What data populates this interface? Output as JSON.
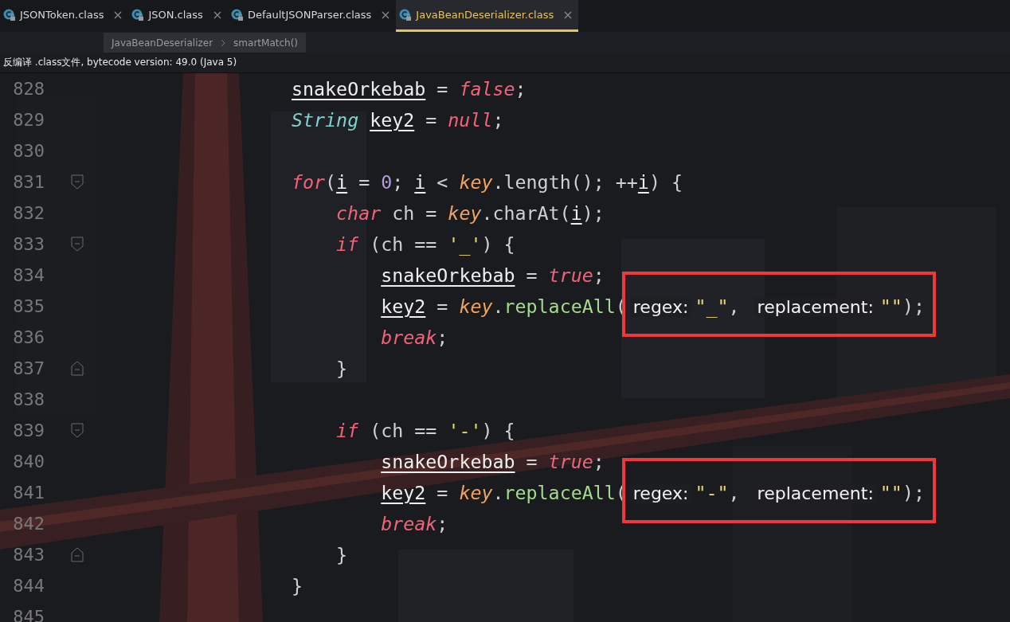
{
  "tabs": [
    {
      "label": "JSONToken.class",
      "selected": false
    },
    {
      "label": "JSON.class",
      "selected": false
    },
    {
      "label": "DefaultJSONParser.class",
      "selected": false
    },
    {
      "label": "JavaBeanDeserializer.class",
      "selected": true
    }
  ],
  "breadcrumb": [
    "JavaBeanDeserializer",
    "smartMatch()"
  ],
  "banner": "反编译 .class文件, bytecode version: 49.0 (Java 5)",
  "lines": [
    {
      "number": "828",
      "tokens": [
        {
          "kind": "var",
          "text": "snakeOrkebab"
        },
        {
          "kind": "plain",
          "text": " = "
        },
        {
          "kind": "kw",
          "text": "false"
        },
        {
          "kind": "plain",
          "text": ";"
        }
      ]
    },
    {
      "number": "829",
      "tokens": [
        {
          "kind": "type",
          "text": "String"
        },
        {
          "kind": "var",
          "text": "key2"
        },
        {
          "kind": "plain",
          "text": " = "
        },
        {
          "kind": "kw",
          "text": "null"
        },
        {
          "kind": "plain",
          "text": ";"
        }
      ]
    },
    {
      "number": "830"
    },
    {
      "number": "831",
      "fold_start": true,
      "tokens": [
        {
          "kind": "kw",
          "text": "for"
        },
        {
          "kind": "plain",
          "text": "("
        },
        {
          "kind": "var",
          "text": "i"
        },
        {
          "kind": "plain",
          "text": " = "
        },
        {
          "kind": "num",
          "text": "0"
        },
        {
          "kind": "plain",
          "text": "; "
        },
        {
          "kind": "var",
          "text": "i"
        },
        {
          "kind": "plain",
          "text": " < "
        },
        {
          "kind": "field",
          "text": "key"
        },
        {
          "kind": "plain",
          "text": ".length(); ++"
        },
        {
          "kind": "var",
          "text": "i"
        },
        {
          "kind": "plain",
          "text": ") {"
        }
      ]
    },
    {
      "number": "832",
      "tokens": [
        {
          "kind": "kw",
          "text": "char"
        },
        {
          "kind": "plain",
          "text": " ch = "
        },
        {
          "kind": "field",
          "text": "key"
        },
        {
          "kind": "plain",
          "text": ".charAt("
        },
        {
          "kind": "var",
          "text": "i"
        },
        {
          "kind": "plain",
          "text": ");"
        }
      ]
    },
    {
      "number": "833",
      "fold_start": true,
      "tokens": [
        {
          "kind": "kw",
          "text": "if"
        },
        {
          "kind": "plain",
          "text": " (ch == "
        },
        {
          "kind": "str",
          "text": "'_'"
        },
        {
          "kind": "plain",
          "text": ") {"
        }
      ]
    },
    {
      "number": "834",
      "tokens": [
        {
          "kind": "var",
          "text": "snakeOrkebab"
        },
        {
          "kind": "plain",
          "text": " = "
        },
        {
          "kind": "kw",
          "text": "true"
        },
        {
          "kind": "plain",
          "text": ";"
        }
      ]
    },
    {
      "number": "835",
      "annotated": true,
      "tokens": [
        {
          "kind": "var",
          "text": "key2"
        },
        {
          "kind": "plain",
          "text": " = "
        },
        {
          "kind": "field",
          "text": "key"
        },
        {
          "kind": "plain",
          "text": "."
        },
        {
          "kind": "method",
          "text": "replaceAll"
        },
        {
          "kind": "plain",
          "text": "("
        },
        {
          "kind": "hint",
          "text": "regex:"
        },
        {
          "kind": "str",
          "text": "\"_\""
        },
        {
          "kind": "plain",
          "text": ", "
        },
        {
          "kind": "hint",
          "text": "replacement:"
        },
        {
          "kind": "str",
          "text": "\"\""
        },
        {
          "kind": "plain",
          "text": ");"
        }
      ]
    },
    {
      "number": "836",
      "tokens": [
        {
          "kind": "kw",
          "text": "break"
        },
        {
          "kind": "plain",
          "text": ";"
        }
      ]
    },
    {
      "number": "837",
      "fold_end": true,
      "tokens": [
        {
          "kind": "plain",
          "text": "}"
        }
      ]
    },
    {
      "number": "838"
    },
    {
      "number": "839",
      "fold_start": true,
      "tokens": [
        {
          "kind": "kw",
          "text": "if"
        },
        {
          "kind": "plain",
          "text": " (ch == "
        },
        {
          "kind": "str",
          "text": "'-'"
        },
        {
          "kind": "plain",
          "text": ") {"
        }
      ]
    },
    {
      "number": "840",
      "tokens": [
        {
          "kind": "var",
          "text": "snakeOrkebab"
        },
        {
          "kind": "plain",
          "text": " = "
        },
        {
          "kind": "kw",
          "text": "true"
        },
        {
          "kind": "plain",
          "text": ";"
        }
      ]
    },
    {
      "number": "841",
      "annotated": true,
      "tokens": [
        {
          "kind": "var",
          "text": "key2"
        },
        {
          "kind": "plain",
          "text": " = "
        },
        {
          "kind": "field",
          "text": "key"
        },
        {
          "kind": "plain",
          "text": "."
        },
        {
          "kind": "method",
          "text": "replaceAll"
        },
        {
          "kind": "plain",
          "text": "("
        },
        {
          "kind": "hint",
          "text": "regex:"
        },
        {
          "kind": "str",
          "text": "\"-\""
        },
        {
          "kind": "plain",
          "text": ", "
        },
        {
          "kind": "hint",
          "text": "replacement:"
        },
        {
          "kind": "str",
          "text": "\"\""
        },
        {
          "kind": "plain",
          "text": ");"
        }
      ]
    },
    {
      "number": "842",
      "tokens": [
        {
          "kind": "kw",
          "text": "break"
        },
        {
          "kind": "plain",
          "text": ";"
        }
      ]
    },
    {
      "number": "843",
      "fold_end": true,
      "tokens": [
        {
          "kind": "plain",
          "text": "}"
        }
      ]
    },
    {
      "number": "844",
      "tokens": [
        {
          "kind": "plain",
          "text": "}"
        }
      ]
    },
    {
      "number": "845"
    }
  ]
}
